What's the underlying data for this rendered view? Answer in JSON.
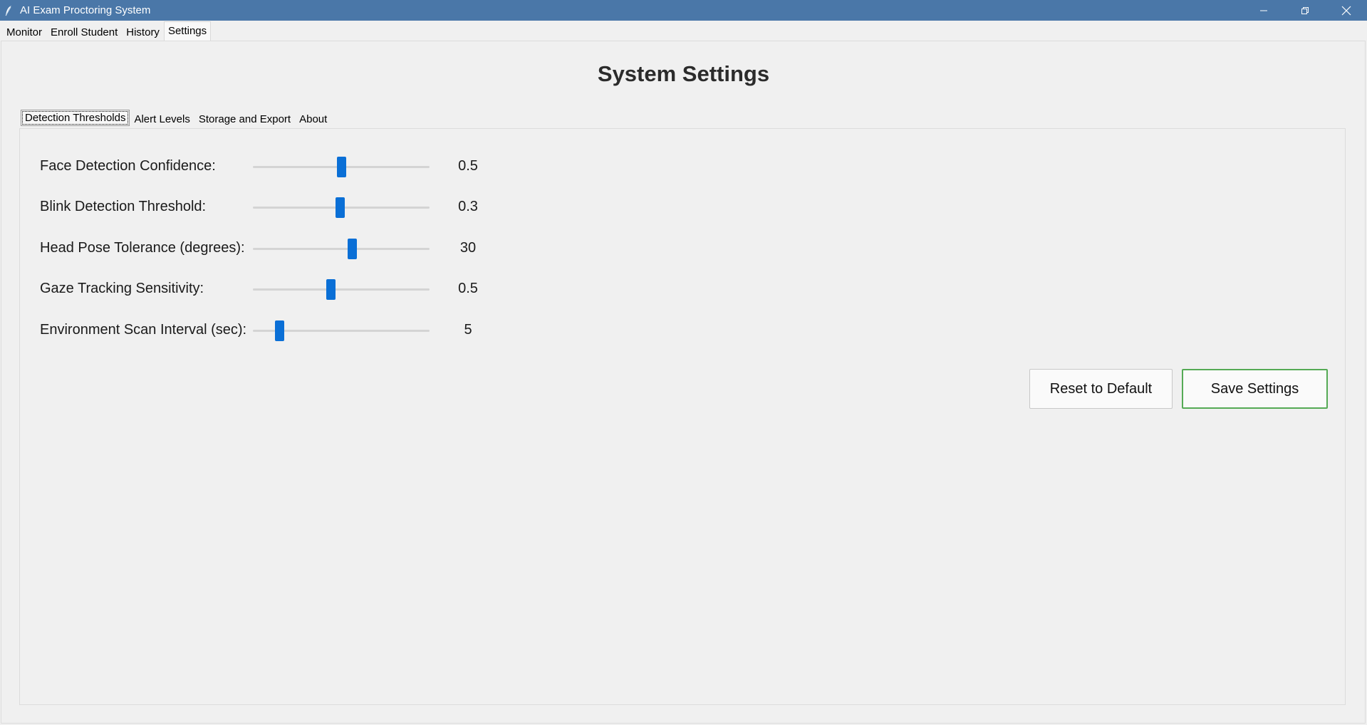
{
  "window": {
    "title": "AI Exam Proctoring System",
    "app_icon": "feather-icon",
    "controls": [
      "minimize-icon",
      "restore-icon",
      "close-icon"
    ]
  },
  "main_tabs": [
    {
      "label": "Monitor",
      "active": false
    },
    {
      "label": "Enroll Student",
      "active": false
    },
    {
      "label": "History",
      "active": false
    },
    {
      "label": "Settings",
      "active": true
    }
  ],
  "page": {
    "title": "System Settings"
  },
  "sub_tabs": [
    {
      "label": "Detection Thresholds",
      "active": true
    },
    {
      "label": "Alert Levels",
      "active": false
    },
    {
      "label": "Storage and Export",
      "active": false
    },
    {
      "label": "About",
      "active": false
    }
  ],
  "settings": [
    {
      "label": "Face Detection Confidence:",
      "value": "0.5",
      "position_fraction": 0.5
    },
    {
      "label": "Blink Detection Threshold:",
      "value": "0.3",
      "position_fraction": 0.49
    },
    {
      "label": "Head Pose Tolerance (degrees):",
      "value": "30",
      "position_fraction": 0.56
    },
    {
      "label": "Gaze Tracking Sensitivity:",
      "value": "0.5",
      "position_fraction": 0.44
    },
    {
      "label": "Environment Scan Interval (sec):",
      "value": "5",
      "position_fraction": 0.15
    }
  ],
  "buttons": {
    "reset_label": "Reset to Default",
    "save_label": "Save Settings"
  },
  "colors": {
    "titlebar": "#4a77a8",
    "slider_thumb": "#0a6fd6",
    "save_border": "#55aa55"
  }
}
